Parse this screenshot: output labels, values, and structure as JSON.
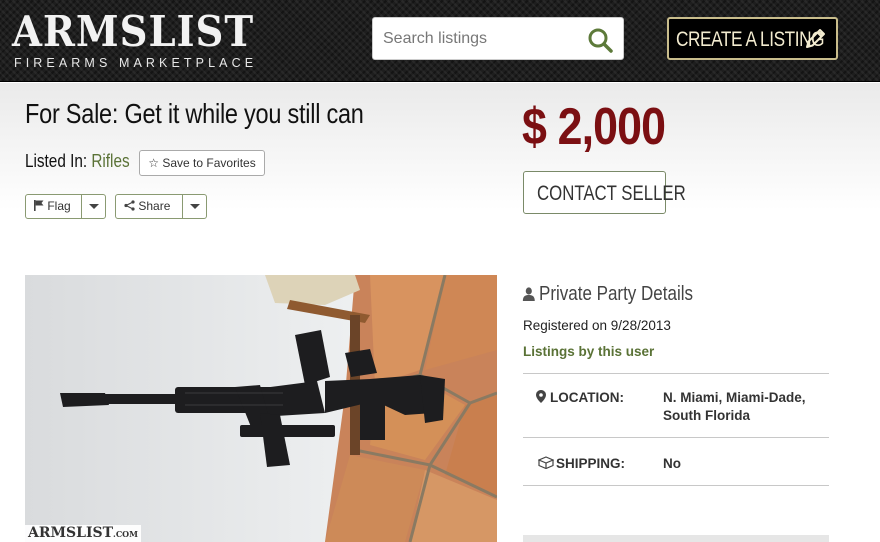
{
  "header": {
    "logo_title": "ARMSLIST",
    "logo_subtitle": "FIREARMS MARKETPLACE",
    "search_placeholder": "Search listings",
    "create_listing_label": "CREATE A LISTING",
    "icons": {
      "search": "search-icon",
      "create": "pencil-icon"
    }
  },
  "listing": {
    "title": "For Sale: Get it while you still can",
    "listed_in_label": "Listed In:",
    "category": "Rifles",
    "save_favorites_label": "Save to Favorites",
    "flag_label": "Flag",
    "share_label": "Share",
    "price": "$ 2,000",
    "contact_label": "CONTACT SELLER",
    "photo_watermark": "ARMSLIST",
    "photo_watermark_suffix": ".COM"
  },
  "seller": {
    "heading": "Private Party Details",
    "registered": "Registered on 9/28/2013",
    "listings_link": "Listings by this user",
    "location_label": "LOCATION:",
    "location_line1": "N. Miami, Miami-Dade,",
    "location_line2": "South Florida",
    "shipping_label": "SHIPPING:",
    "shipping_value": "No"
  },
  "colors": {
    "price": "#7b0f12",
    "link_green": "#5a7236",
    "header_bg": "#1e1e1e",
    "create_border": "#c9bd8c"
  }
}
